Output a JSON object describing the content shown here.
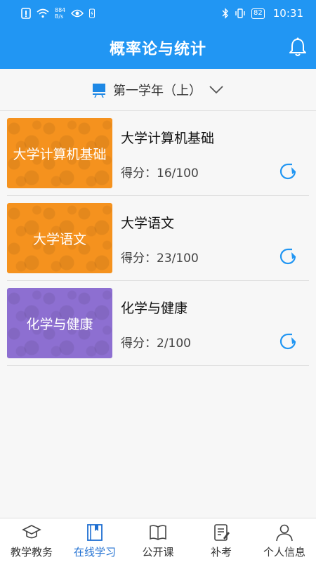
{
  "status_bar": {
    "net_speed_value": "884",
    "net_speed_unit": "B/s",
    "battery": "82",
    "time": "10:31"
  },
  "header": {
    "title": "概率论与统计",
    "bell_icon": "bell-icon"
  },
  "semester": {
    "label": "第一学年（上）",
    "icon": "chalkboard-icon",
    "dropdown_icon": "chevron-down-icon"
  },
  "courses": [
    {
      "thumb_text": "大学计算机基础",
      "name": "大学计算机基础",
      "score": "得分：16/100",
      "color": "#f5921e"
    },
    {
      "thumb_text": "大学语文",
      "name": "大学语文",
      "score": "得分：23/100",
      "color": "#f5921e"
    },
    {
      "thumb_text": "化学与健康",
      "name": "化学与健康",
      "score": "得分：2/100",
      "color": "#8d6fd1"
    }
  ],
  "bottom_nav": [
    {
      "label": "教学教务",
      "icon": "graduation-cap-icon",
      "active": false
    },
    {
      "label": "在线学习",
      "icon": "book-icon",
      "active": true
    },
    {
      "label": "公开课",
      "icon": "open-book-icon",
      "active": false
    },
    {
      "label": "补考",
      "icon": "exam-paper-icon",
      "active": false
    },
    {
      "label": "个人信息",
      "icon": "person-icon",
      "active": false
    }
  ],
  "colors": {
    "primary": "#2196f3",
    "nav_active": "#1f6fd1",
    "refresh": "#2196f3"
  }
}
